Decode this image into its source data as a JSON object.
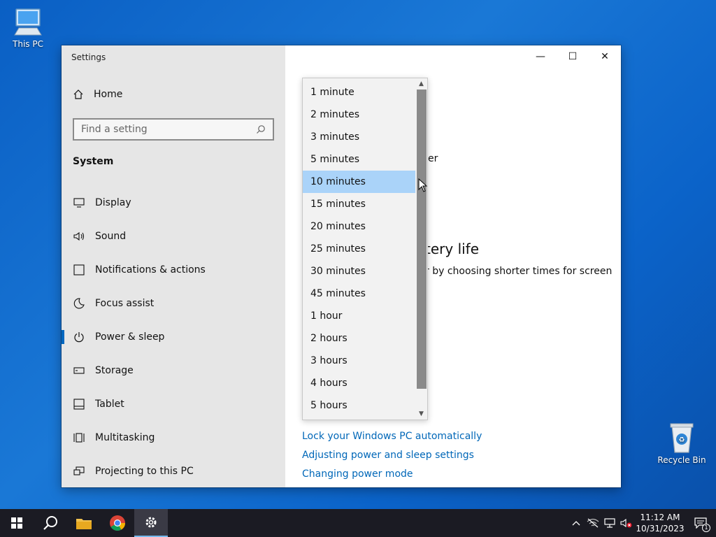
{
  "desktop": {
    "this_pc_label": "This PC",
    "recycle_bin_label": "Recycle Bin"
  },
  "window": {
    "title": "Settings",
    "controls": {
      "minimize": "—",
      "maximize": "☐",
      "close": "✕"
    }
  },
  "sidebar": {
    "home_label": "Home",
    "search_placeholder": "Find a setting",
    "section_label": "System",
    "items": [
      {
        "label": "Display",
        "icon": "monitor-icon"
      },
      {
        "label": "Sound",
        "icon": "speaker-icon"
      },
      {
        "label": "Notifications & actions",
        "icon": "notification-icon"
      },
      {
        "label": "Focus assist",
        "icon": "moon-icon"
      },
      {
        "label": "Power & sleep",
        "icon": "power-icon",
        "active": true
      },
      {
        "label": "Storage",
        "icon": "storage-icon"
      },
      {
        "label": "Tablet",
        "icon": "tablet-icon"
      },
      {
        "label": "Multitasking",
        "icon": "multitasking-icon"
      },
      {
        "label": "Projecting to this PC",
        "icon": "projecting-icon"
      }
    ]
  },
  "content": {
    "partial_text_1": "er",
    "partial_heading": "tery life",
    "partial_text_2": "r by choosing shorter times for screen",
    "links": [
      "Lock your Windows PC automatically",
      "Adjusting power and sleep settings",
      "Changing power mode"
    ]
  },
  "dropdown": {
    "selected": "10 minutes",
    "options": [
      "1 minute",
      "2 minutes",
      "3 minutes",
      "5 minutes",
      "10 minutes",
      "15 minutes",
      "20 minutes",
      "25 minutes",
      "30 minutes",
      "45 minutes",
      "1 hour",
      "2 hours",
      "3 hours",
      "4 hours",
      "5 hours"
    ]
  },
  "taskbar": {
    "time": "11:12 AM",
    "date": "10/31/2023",
    "notification_count": "1"
  },
  "colors": {
    "accent": "#0067c0",
    "link": "#0067b8",
    "selected_option": "#aad3f9"
  }
}
